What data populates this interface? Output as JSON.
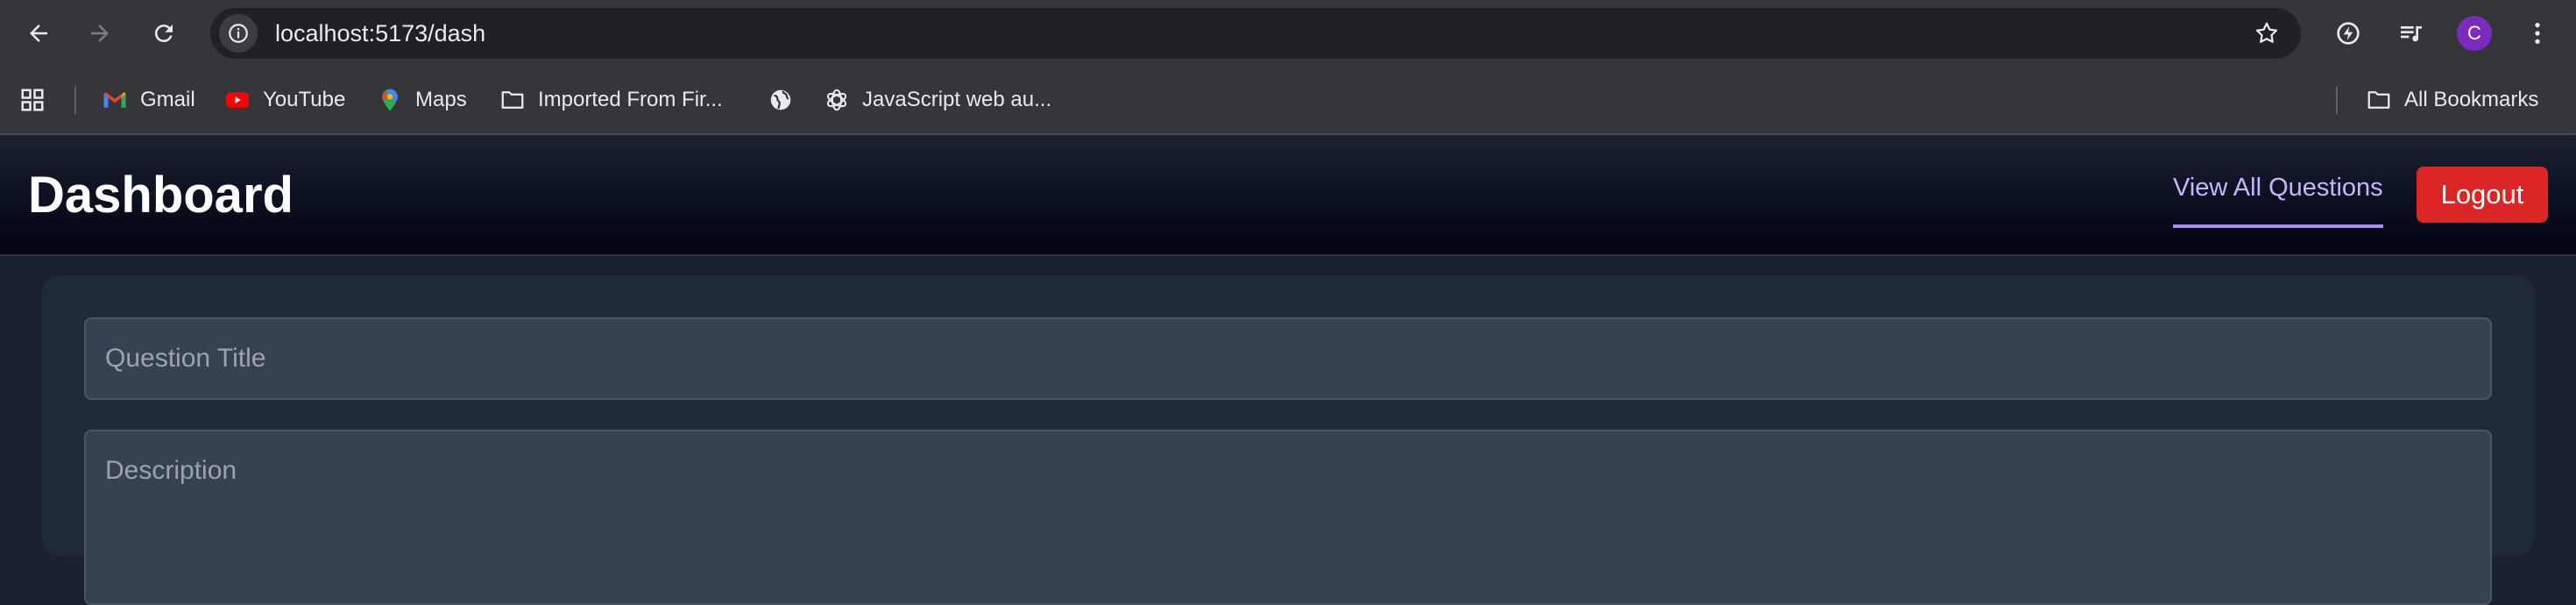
{
  "browser": {
    "url": "localhost:5173/dash",
    "avatar_initial": "C",
    "bookmarks": [
      {
        "label": "Gmail",
        "icon": "gmail-icon"
      },
      {
        "label": "YouTube",
        "icon": "youtube-icon"
      },
      {
        "label": "Maps",
        "icon": "maps-icon"
      },
      {
        "label": "Imported From Fir...",
        "icon": "folder-icon"
      },
      {
        "label": "",
        "icon": "globe-icon"
      },
      {
        "label": "JavaScript web au...",
        "icon": "openai-icon"
      }
    ],
    "all_bookmarks_label": "All Bookmarks"
  },
  "header": {
    "title": "Dashboard",
    "view_all_label": "View All Questions",
    "logout_label": "Logout"
  },
  "form": {
    "title_placeholder": "Question Title",
    "description_placeholder": "Description"
  },
  "colors": {
    "accent": "#a78bfa",
    "danger": "#dc2626",
    "card": "#1f2937",
    "input": "#374151"
  }
}
